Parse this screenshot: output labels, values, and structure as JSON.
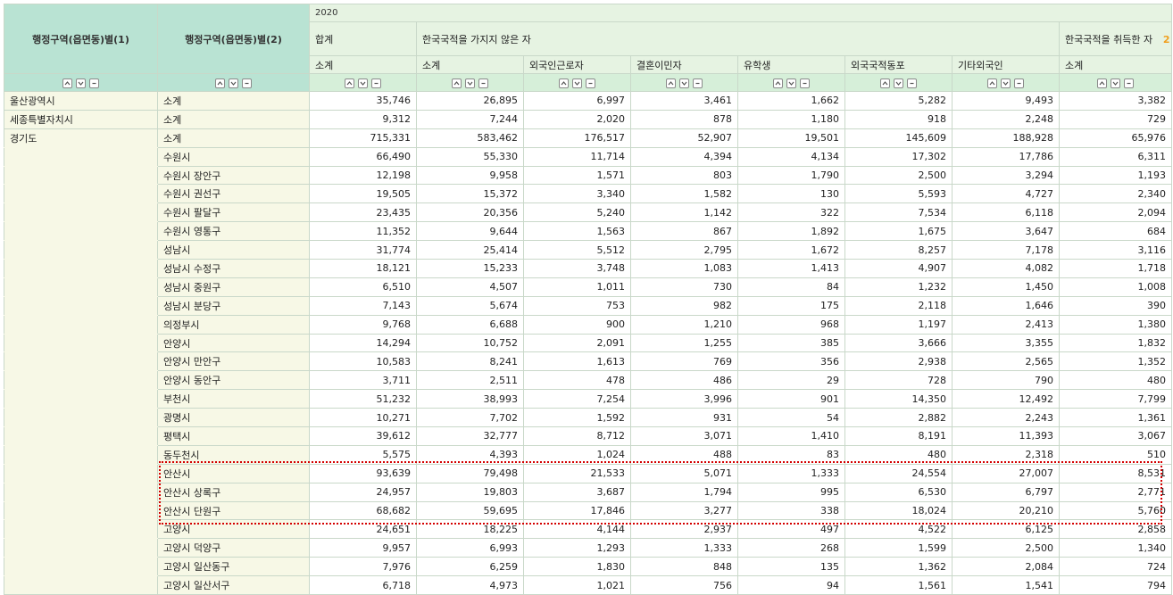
{
  "header": {
    "row_col1": "행정구역(읍면동)별(1)",
    "row_col2": "행정구역(읍면동)별(2)",
    "year": "2020",
    "group_total": "합계",
    "group_non_korean": "한국국적을 가지지 않은 자",
    "group_naturalized": "한국국적을 취득한 자",
    "group_cut": "2",
    "sub": [
      "소계",
      "소계",
      "외국인근로자",
      "결혼이민자",
      "유학생",
      "외국국적동포",
      "기타외국인",
      "소계"
    ]
  },
  "rows": [
    {
      "r1": "울산광역시",
      "r2": "소계",
      "v": [
        "35,746",
        "26,895",
        "6,997",
        "3,461",
        "1,662",
        "5,282",
        "9,493",
        "3,382"
      ]
    },
    {
      "r1": "세종특별자치시",
      "r2": "소계",
      "v": [
        "9,312",
        "7,244",
        "2,020",
        "878",
        "1,180",
        "918",
        "2,248",
        "729"
      ]
    },
    {
      "r1": "경기도",
      "r2": "소계",
      "v": [
        "715,331",
        "583,462",
        "176,517",
        "52,907",
        "19,501",
        "145,609",
        "188,928",
        "65,976"
      ]
    },
    {
      "r1": "",
      "r2": "수원시",
      "v": [
        "66,490",
        "55,330",
        "11,714",
        "4,394",
        "4,134",
        "17,302",
        "17,786",
        "6,311"
      ]
    },
    {
      "r1": "",
      "r2": "수원시 장안구",
      "v": [
        "12,198",
        "9,958",
        "1,571",
        "803",
        "1,790",
        "2,500",
        "3,294",
        "1,193"
      ]
    },
    {
      "r1": "",
      "r2": "수원시 권선구",
      "v": [
        "19,505",
        "15,372",
        "3,340",
        "1,582",
        "130",
        "5,593",
        "4,727",
        "2,340"
      ]
    },
    {
      "r1": "",
      "r2": "수원시 팔달구",
      "v": [
        "23,435",
        "20,356",
        "5,240",
        "1,142",
        "322",
        "7,534",
        "6,118",
        "2,094"
      ]
    },
    {
      "r1": "",
      "r2": "수원시 영통구",
      "v": [
        "11,352",
        "9,644",
        "1,563",
        "867",
        "1,892",
        "1,675",
        "3,647",
        "684"
      ]
    },
    {
      "r1": "",
      "r2": "성남시",
      "v": [
        "31,774",
        "25,414",
        "5,512",
        "2,795",
        "1,672",
        "8,257",
        "7,178",
        "3,116"
      ]
    },
    {
      "r1": "",
      "r2": "성남시 수정구",
      "v": [
        "18,121",
        "15,233",
        "3,748",
        "1,083",
        "1,413",
        "4,907",
        "4,082",
        "1,718"
      ]
    },
    {
      "r1": "",
      "r2": "성남시 중원구",
      "v": [
        "6,510",
        "4,507",
        "1,011",
        "730",
        "84",
        "1,232",
        "1,450",
        "1,008"
      ]
    },
    {
      "r1": "",
      "r2": "성남시 분당구",
      "v": [
        "7,143",
        "5,674",
        "753",
        "982",
        "175",
        "2,118",
        "1,646",
        "390"
      ]
    },
    {
      "r1": "",
      "r2": "의정부시",
      "v": [
        "9,768",
        "6,688",
        "900",
        "1,210",
        "968",
        "1,197",
        "2,413",
        "1,380"
      ]
    },
    {
      "r1": "",
      "r2": "안양시",
      "v": [
        "14,294",
        "10,752",
        "2,091",
        "1,255",
        "385",
        "3,666",
        "3,355",
        "1,832"
      ]
    },
    {
      "r1": "",
      "r2": "안양시 만안구",
      "v": [
        "10,583",
        "8,241",
        "1,613",
        "769",
        "356",
        "2,938",
        "2,565",
        "1,352"
      ]
    },
    {
      "r1": "",
      "r2": "안양시 동안구",
      "v": [
        "3,711",
        "2,511",
        "478",
        "486",
        "29",
        "728",
        "790",
        "480"
      ]
    },
    {
      "r1": "",
      "r2": "부천시",
      "v": [
        "51,232",
        "38,993",
        "7,254",
        "3,996",
        "901",
        "14,350",
        "12,492",
        "7,799"
      ]
    },
    {
      "r1": "",
      "r2": "광명시",
      "v": [
        "10,271",
        "7,702",
        "1,592",
        "931",
        "54",
        "2,882",
        "2,243",
        "1,361"
      ]
    },
    {
      "r1": "",
      "r2": "평택시",
      "v": [
        "39,612",
        "32,777",
        "8,712",
        "3,071",
        "1,410",
        "8,191",
        "11,393",
        "3,067"
      ]
    },
    {
      "r1": "",
      "r2": "동두천시",
      "v": [
        "5,575",
        "4,393",
        "1,024",
        "488",
        "83",
        "480",
        "2,318",
        "510"
      ]
    },
    {
      "r1": "",
      "r2": "안산시",
      "v": [
        "93,639",
        "79,498",
        "21,533",
        "5,071",
        "1,333",
        "24,554",
        "27,007",
        "8,531"
      ]
    },
    {
      "r1": "",
      "r2": "안산시 상록구",
      "v": [
        "24,957",
        "19,803",
        "3,687",
        "1,794",
        "995",
        "6,530",
        "6,797",
        "2,771"
      ]
    },
    {
      "r1": "",
      "r2": "안산시 단원구",
      "v": [
        "68,682",
        "59,695",
        "17,846",
        "3,277",
        "338",
        "18,024",
        "20,210",
        "5,760"
      ]
    },
    {
      "r1": "",
      "r2": "고양시",
      "v": [
        "24,651",
        "18,225",
        "4,144",
        "2,937",
        "497",
        "4,522",
        "6,125",
        "2,858"
      ]
    },
    {
      "r1": "",
      "r2": "고양시 덕양구",
      "v": [
        "9,957",
        "6,993",
        "1,293",
        "1,333",
        "268",
        "1,599",
        "2,500",
        "1,340"
      ]
    },
    {
      "r1": "",
      "r2": "고양시 일산동구",
      "v": [
        "7,976",
        "6,259",
        "1,830",
        "848",
        "135",
        "1,362",
        "2,084",
        "724"
      ]
    },
    {
      "r1": "",
      "r2": "고양시 일산서구",
      "v": [
        "6,718",
        "4,973",
        "1,021",
        "756",
        "94",
        "1,561",
        "1,541",
        "794"
      ]
    }
  ]
}
